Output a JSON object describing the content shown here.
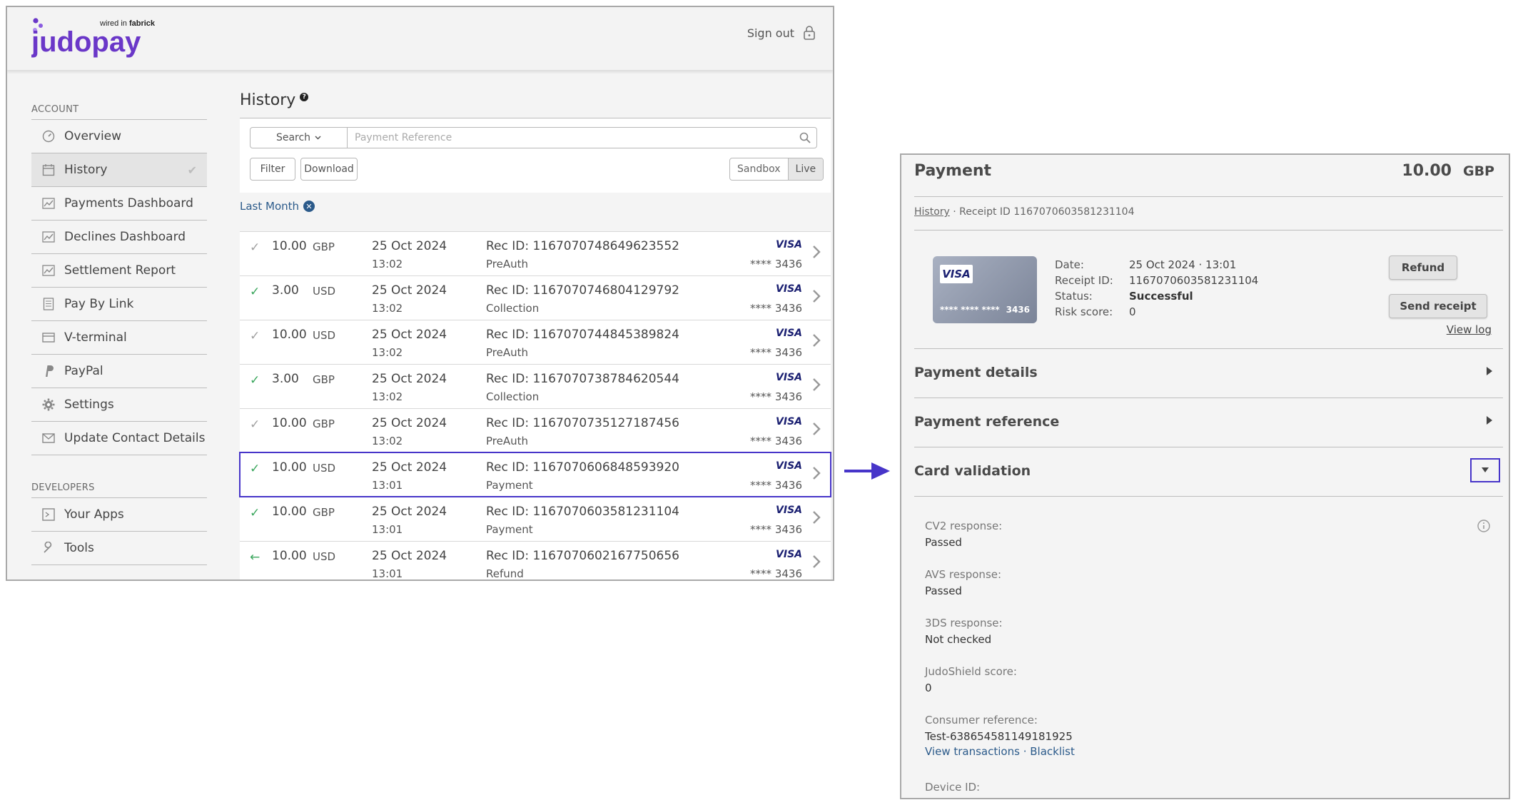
{
  "app": {
    "logo_text": "judopay",
    "logo_tagline_prefix": "wired in",
    "logo_tagline_brand": "fabrick",
    "brand_color": "#6a37c8",
    "highlight_color": "#4735c9"
  },
  "header": {
    "sign_out_label": "Sign out",
    "sign_out_icon": "lock-icon"
  },
  "sidebar": {
    "account_heading": "ACCOUNT",
    "account_items": [
      {
        "label": "Overview",
        "icon": "gauge-icon"
      },
      {
        "label": "History",
        "icon": "calendar-icon",
        "active": true
      },
      {
        "label": "Payments Dashboard",
        "icon": "chart-icon"
      },
      {
        "label": "Declines Dashboard",
        "icon": "chart-icon"
      },
      {
        "label": "Settlement Report",
        "icon": "chart-icon"
      },
      {
        "label": "Pay By Link",
        "icon": "document-icon"
      },
      {
        "label": "V-terminal",
        "icon": "terminal-icon"
      },
      {
        "label": "PayPal",
        "icon": "paypal-icon"
      },
      {
        "label": "Settings",
        "icon": "gear-icon"
      },
      {
        "label": "Update Contact Details",
        "icon": "envelope-icon"
      }
    ],
    "developers_heading": "DEVELOPERS",
    "developer_items": [
      {
        "label": "Your Apps",
        "icon": "apps-icon"
      },
      {
        "label": "Tools",
        "icon": "wrench-icon"
      }
    ]
  },
  "history": {
    "title": "History",
    "search_button": "Search",
    "search_placeholder": "Payment Reference",
    "filter_button": "Filter",
    "download_button": "Download",
    "env_options": [
      "Sandbox",
      "Live"
    ],
    "env_selected": "Live",
    "filter_chip": "Last Month",
    "rows": [
      {
        "status": "grey",
        "amount": "10.00",
        "currency": "GBP",
        "date": "25 Oct 2024",
        "time": "13:02",
        "rec": "Rec ID: 1167070748649623552",
        "type": "PreAuth",
        "brand": "VISA",
        "last4": "**** 3436"
      },
      {
        "status": "green",
        "amount": "3.00",
        "currency": "USD",
        "date": "25 Oct 2024",
        "time": "13:02",
        "rec": "Rec ID: 1167070746804129792",
        "type": "Collection",
        "brand": "VISA",
        "last4": "**** 3436"
      },
      {
        "status": "grey",
        "amount": "10.00",
        "currency": "USD",
        "date": "25 Oct 2024",
        "time": "13:02",
        "rec": "Rec ID: 1167070744845389824",
        "type": "PreAuth",
        "brand": "VISA",
        "last4": "**** 3436"
      },
      {
        "status": "green",
        "amount": "3.00",
        "currency": "GBP",
        "date": "25 Oct 2024",
        "time": "13:02",
        "rec": "Rec ID: 1167070738784620544",
        "type": "Collection",
        "brand": "VISA",
        "last4": "**** 3436"
      },
      {
        "status": "grey",
        "amount": "10.00",
        "currency": "GBP",
        "date": "25 Oct 2024",
        "time": "13:02",
        "rec": "Rec ID: 1167070735127187456",
        "type": "PreAuth",
        "brand": "VISA",
        "last4": "**** 3436"
      },
      {
        "status": "green",
        "amount": "10.00",
        "currency": "USD",
        "date": "25 Oct 2024",
        "time": "13:01",
        "rec": "Rec ID: 1167070606848593920",
        "type": "Payment",
        "brand": "VISA",
        "last4": "**** 3436",
        "highlighted": true
      },
      {
        "status": "green",
        "amount": "10.00",
        "currency": "GBP",
        "date": "25 Oct 2024",
        "time": "13:01",
        "rec": "Rec ID: 1167070603581231104",
        "type": "Payment",
        "brand": "VISA",
        "last4": "**** 3436"
      },
      {
        "status": "refund",
        "amount": "10.00",
        "currency": "USD",
        "date": "25 Oct 2024",
        "time": "13:01",
        "rec": "Rec ID: 1167070602167750656",
        "type": "Refund",
        "brand": "VISA",
        "last4": "**** 3436"
      }
    ]
  },
  "detail": {
    "title": "Payment",
    "amount": "10.00",
    "currency": "GBP",
    "breadcrumb_link": "History",
    "breadcrumb_rest": " · Receipt ID 1167070603581231104",
    "card_brand": "VISA",
    "card_masked": "**** **** ****",
    "card_last4": "3436",
    "fields": {
      "date_label": "Date:",
      "date_value": "25 Oct 2024 · 13:01",
      "receipt_label": "Receipt ID:",
      "receipt_value": "1167070603581231104",
      "status_label": "Status:",
      "status_value": "Successful",
      "risk_label": "Risk score:",
      "risk_value": "0"
    },
    "refund_button": "Refund",
    "send_receipt_button": "Send receipt",
    "view_log_link": "View log",
    "sections": [
      "Payment details",
      "Payment reference",
      "Card validation"
    ],
    "card_validation": {
      "cv2_label": "CV2 response:",
      "cv2_value": "Passed",
      "avs_label": "AVS response:",
      "avs_value": "Passed",
      "threeds_label": "3DS response:",
      "threeds_value": "Not checked",
      "judoshield_label": "JudoShield score:",
      "judoshield_value": "0",
      "consumer_label": "Consumer reference:",
      "consumer_value": "Test-638654581149181925",
      "view_transactions_link": "View transactions",
      "link_separator": " · ",
      "blacklist_link": "Blacklist",
      "device_label": "Device ID:"
    }
  }
}
